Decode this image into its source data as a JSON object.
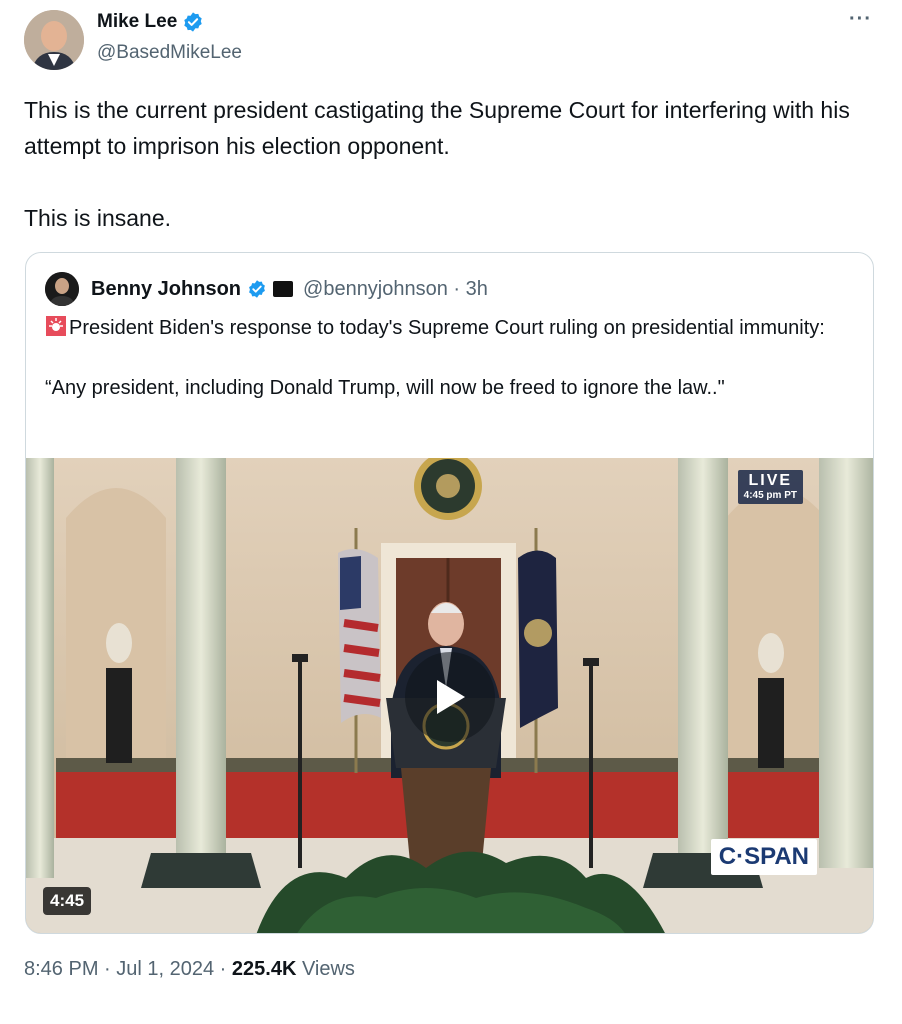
{
  "author": {
    "name": "Mike Lee",
    "handle": "@BasedMikeLee",
    "verified": true
  },
  "more_label": "···",
  "tweet": {
    "paragraphs": [
      "This is the current president castigating the Supreme Court for interfering with his attempt to imprison his election opponent.",
      "This is insane."
    ]
  },
  "quote": {
    "name": "Benny Johnson",
    "handle_time": "@bennyjohnson · 3h",
    "text_line1": "President Biden's response to today's Supreme Court ruling on presidential immunity:",
    "text_line2": "“Any president, including Donald Trump, will now be freed to ignore the law..\"",
    "video": {
      "live_label": "LIVE",
      "live_time": "4:45 pm PT",
      "network": "C·SPAN",
      "duration": "4:45"
    }
  },
  "meta": {
    "time_date": "8:46 PM · Jul 1, 2024 · ",
    "views_count": "225.4K",
    "views_label": " Views"
  },
  "colors": {
    "text": "#0f1419",
    "secondary": "#536471",
    "verified": "#1d9bf0",
    "border": "#cfd9de"
  }
}
